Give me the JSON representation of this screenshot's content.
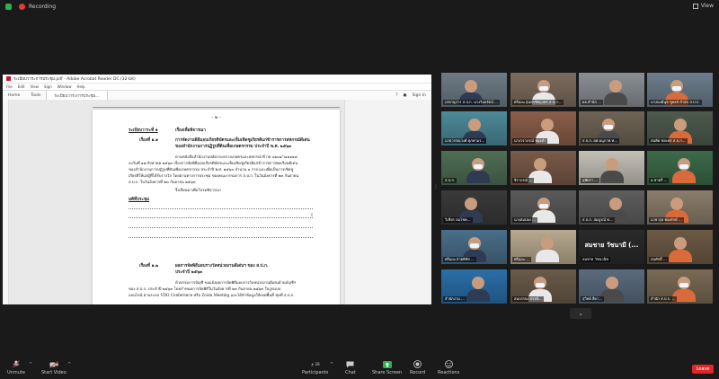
{
  "top": {
    "recording": "Recording",
    "view": "View"
  },
  "acrobat": {
    "title": "ระเบียบวาระการประชุม.pdf - Adobe Acrobat Reader DC (32-bit)",
    "menu": [
      "File",
      "Edit",
      "View",
      "Sign",
      "Window",
      "Help"
    ],
    "tabs": {
      "home": "Home",
      "tools": "Tools",
      "doc": "ระเบียบวาระการประชุม..."
    },
    "signin": "Sign In"
  },
  "document": {
    "page_number": "- ๒ -",
    "agenda_1": "ระเบียบวาระที่ ๑",
    "agenda_1_topic": "เรื่องเพื่อพิจารณา",
    "item_11": "เรื่องที่ ๑.๑",
    "item_11_title_1": "การจัดงานพิธีมอบเกียรติบัตรและเข็มเชิดชูเกียรติแก่ข้าราชการสหกรณ์ดีเด่น",
    "item_11_title_2": "ของสำนักงานการปฏิรูปที่ดินเพื่อเกษตรกรรม ประจำปี พ.ศ. ๒๕๖๓",
    "para_1a": "ตามหนังสือสำนักงานปลัดกระทรวงเกษตรและสหกรณ์ ที่ กษ ๐๒๐๑/ว๑๑๑๑๘",
    "para_1b": "ลงวันที่ ๑๗ สิงหาคม ๒๕๖๓ เรื่องการจัดพิธีมอบเกียรติบัตรและเข็มเชิดชูเกียรติแก่ข้าราชการพลเรือนดีเด่น",
    "para_1c": "ของสำนักงานการปฏิรูปที่ดินเพื่อเกษตรกรรม ประจำปี พ.ศ. ๒๕๖๓ จำนวน ๑ ราย และเพื่อเป็นการเชิดชู",
    "para_1d": "เกียรติให้แก่ผู้ที่ได้รับรางวัล โดยผ่านทางการประชุม ของคณะกรรมการ ส.ป.ก. ในวันอังคารที่ ๒๓ กันยายน",
    "para_1e": "ส.ป.ก. ในวันอังคารที่ ๒๓ กันยายน ๒๕๖๓",
    "para_1f": "จึงเรียนมาเพื่อโปรดพิจารณา",
    "resolution": "มติที่ประชุม",
    "item_12": "เรื่องที่ ๑.๒",
    "item_12_title_1": "ผลการจัดพิธีมอบรางวัลหน่วยงานดีเด่นฯ ของ ส.ป.ก.",
    "item_12_title_2": "ประจำปี ๒๕๖๓",
    "para_2a": "ด้วยกรมการบัญชี ขอแจ้งผลการจัดพิธีมอบรางวัลหน่วยงานดีเด่นด้านบัญชีฯ",
    "para_2b": "ของ ส.ป.ก. ประจำปี ๒๕๖๓ โดยกำหนดการจัดพิธีในวันอังคารที่ ๒๓ กันยายน ๒๕๖๓ ในรูปแบบ",
    "para_2c": "ออนไลน์ ผ่านระบบ VDO Conference หรือ Zoom Meeting และได้ทำข้อมูลให้เขตพื้นที่ ชุดที่ ส.ป.ก."
  },
  "participants": [
    {
      "name": "เลขานุการ ส.ป.ก. นางวิมลรัตน์ ...",
      "bg": "#6e7b86"
    },
    {
      "name": "ศรีเมฆ สุนทรชัยกุลพร ส.ป.ก...",
      "bg": "#7d6c5e"
    },
    {
      "name": "ผอ.สำนัก ...",
      "bg": "#8a8f94"
    },
    {
      "name": "นางนงค์นุช ชูพงษ์ สำนัก ส.ป.ก.",
      "bg": "#6d7d8c"
    },
    {
      "name": "นายวรรณวงศ์ ศุภทามร...",
      "bg": "#4d8a9a"
    },
    {
      "name": "นางวราภรณ์ ทองคำ",
      "bg": "#8b5e4a"
    },
    {
      "name": "ส.ป.ก. ผศ.อนุภาพ ท...",
      "bg": "#6f6455"
    },
    {
      "name": "สมคิด ชยะพร ส.ป.ก...",
      "bg": "#4f5b4f"
    },
    {
      "name": "ส.ป.ก.",
      "bg": "#4f6e55"
    },
    {
      "name": "จิราภรณ์ ...",
      "bg": "#7a5a48"
    },
    {
      "name": "สุพัตรา ...",
      "bg": "#c4c0b8"
    },
    {
      "name": "อ.ชาตรี ...",
      "bg": "#3d6a4a"
    },
    {
      "name": "วิเชียร สมโชค...",
      "bg": "#3a3a3a"
    },
    {
      "name": "นางสมปอง ...",
      "bg": "#5a5a5a"
    },
    {
      "name": "ส.ป.ก. สมบูรณ์ ท...",
      "bg": "#5e5e5e"
    },
    {
      "name": "นายวรุธ ทองรักษ์ ...",
      "bg": "#8b7d6b"
    },
    {
      "name": "ศรีเมฆ สายพิชัย ...",
      "bg": "#4a6e8a"
    },
    {
      "name": "ศรีเมฆ ...",
      "bg": "#b8a98f"
    },
    {
      "name": "สมชาย วัชนวนิช",
      "bg": "#2a2a2a",
      "big": "สมชาย วัชนามี (..."
    },
    {
      "name": "สมศักดิ์ ...",
      "bg": "#6d5a45"
    },
    {
      "name": "สำนักงาน ...",
      "bg": "#2a6fa8"
    },
    {
      "name": "สมบรรจง สรรพ์...",
      "bg": "#6a5b4a"
    },
    {
      "name": "สุวิทย์ สีดา...",
      "bg": "#5a6b7d"
    },
    {
      "name": "สำนัก ส.ป.ก. ...",
      "bg": "#7a6a55"
    }
  ],
  "toolbar": {
    "unmute": "Unmute",
    "start_video": "Start Video",
    "participants": "Participants",
    "participant_count": "28",
    "chat": "Chat",
    "share_screen": "Share Screen",
    "record": "Record",
    "reactions": "Reactions",
    "leave": "Leave"
  },
  "colors": {
    "share_green": "#2bb24c",
    "leave_red": "#e02828",
    "record_red": "#e23b3b"
  }
}
